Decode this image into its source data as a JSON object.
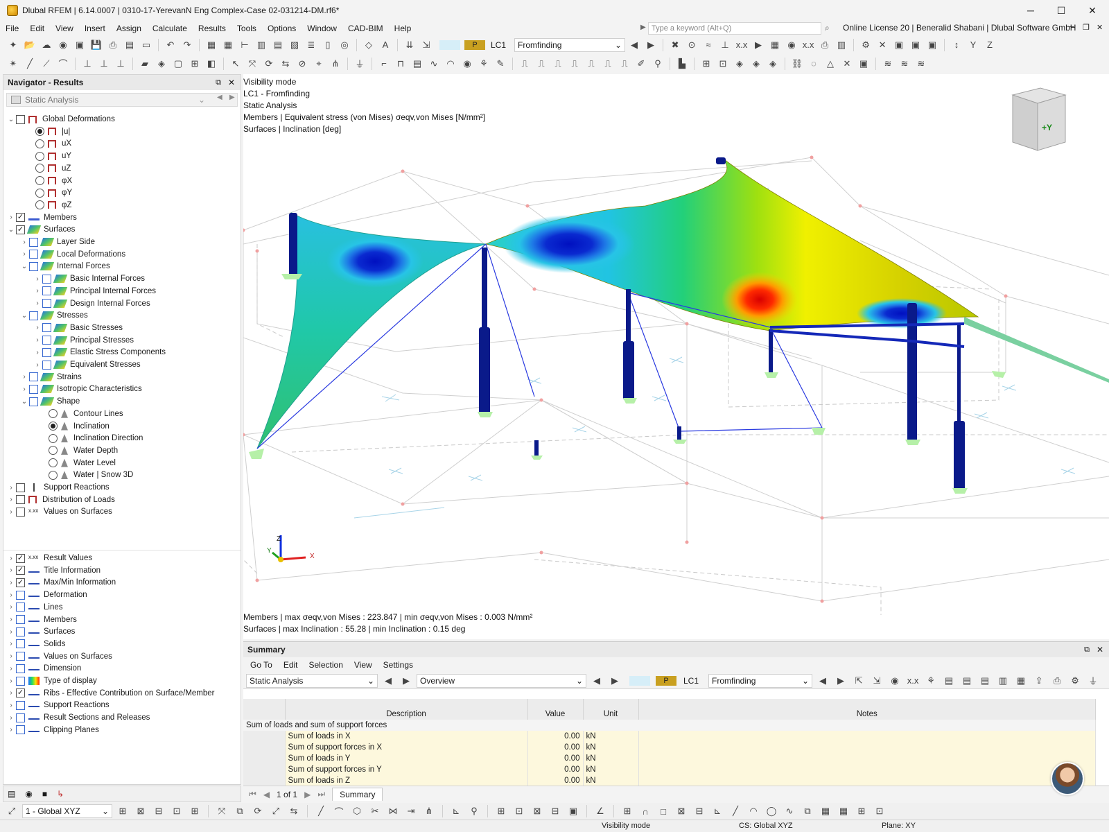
{
  "window": {
    "title": "Dlubal RFEM | 6.14.0007 | 0310-17-YerevanN Eng Complex-Case 02-031214-DM.rf6*",
    "minimize": "─",
    "maximize": "☐",
    "close": "✕"
  },
  "menu": {
    "items": [
      "File",
      "Edit",
      "View",
      "Insert",
      "Assign",
      "Calculate",
      "Results",
      "Tools",
      "Options",
      "Window",
      "CAD-BIM",
      "Help"
    ],
    "search_placeholder": "Type a keyword (Alt+Q)",
    "license": "Online License 20 | Beneralid Shabani | Dlubal Software GmbH"
  },
  "toolbar": {
    "loadcase_tag": "P",
    "loadcase_id": "LC1",
    "loadcase_name": "Fromfinding"
  },
  "navigator": {
    "title": "Navigator - Results",
    "analysis": "Static Analysis",
    "tree": [
      {
        "label": "Global Deformations",
        "level": 0,
        "type": "cb",
        "checked": false,
        "expanded": true,
        "icon": "deformation-icon"
      },
      {
        "label": "|u|",
        "level": 1,
        "type": "rb",
        "checked": true,
        "icon": "deformation-icon"
      },
      {
        "label": "uX",
        "level": 1,
        "type": "rb",
        "checked": false,
        "icon": "deformation-icon"
      },
      {
        "label": "uY",
        "level": 1,
        "type": "rb",
        "checked": false,
        "icon": "deformation-icon"
      },
      {
        "label": "uZ",
        "level": 1,
        "type": "rb",
        "checked": false,
        "icon": "deformation-icon"
      },
      {
        "label": "φX",
        "level": 1,
        "type": "rb",
        "checked": false,
        "icon": "deformation-icon"
      },
      {
        "label": "φY",
        "level": 1,
        "type": "rb",
        "checked": false,
        "icon": "deformation-icon"
      },
      {
        "label": "φZ",
        "level": 1,
        "type": "rb",
        "checked": false,
        "icon": "deformation-icon"
      },
      {
        "label": "Members",
        "level": 0,
        "type": "cb",
        "checked": true,
        "expanded": false,
        "icon": "members-icon"
      },
      {
        "label": "Surfaces",
        "level": 0,
        "type": "cb",
        "checked": true,
        "expanded": true,
        "icon": "surface-icon"
      },
      {
        "label": "Layer Side",
        "level": 1,
        "type": "cb",
        "checked": false,
        "expanded": false,
        "icon": "surface-icon"
      },
      {
        "label": "Local Deformations",
        "level": 1,
        "type": "cb",
        "checked": false,
        "expanded": false,
        "icon": "surface-icon"
      },
      {
        "label": "Internal Forces",
        "level": 1,
        "type": "cb",
        "checked": false,
        "expanded": true,
        "icon": "surface-icon"
      },
      {
        "label": "Basic Internal Forces",
        "level": 2,
        "type": "cb",
        "checked": false,
        "expanded": false,
        "icon": "surface-icon"
      },
      {
        "label": "Principal Internal Forces",
        "level": 2,
        "type": "cb",
        "checked": false,
        "expanded": false,
        "icon": "surface-icon"
      },
      {
        "label": "Design Internal Forces",
        "level": 2,
        "type": "cb",
        "checked": false,
        "expanded": false,
        "icon": "surface-icon"
      },
      {
        "label": "Stresses",
        "level": 1,
        "type": "cb",
        "checked": false,
        "expanded": true,
        "icon": "surface-icon"
      },
      {
        "label": "Basic Stresses",
        "level": 2,
        "type": "cb",
        "checked": false,
        "expanded": false,
        "icon": "surface-icon"
      },
      {
        "label": "Principal Stresses",
        "level": 2,
        "type": "cb",
        "checked": false,
        "expanded": false,
        "icon": "surface-icon"
      },
      {
        "label": "Elastic Stress Components",
        "level": 2,
        "type": "cb",
        "checked": false,
        "expanded": false,
        "icon": "surface-icon"
      },
      {
        "label": "Equivalent Stresses",
        "level": 2,
        "type": "cb",
        "checked": false,
        "expanded": false,
        "icon": "surface-icon"
      },
      {
        "label": "Strains",
        "level": 1,
        "type": "cb",
        "checked": false,
        "expanded": false,
        "icon": "surface-icon"
      },
      {
        "label": "Isotropic Characteristics",
        "level": 1,
        "type": "cb",
        "checked": false,
        "expanded": false,
        "icon": "surface-icon"
      },
      {
        "label": "Shape",
        "level": 1,
        "type": "cb",
        "checked": false,
        "expanded": true,
        "icon": "surface-icon"
      },
      {
        "label": "Contour Lines",
        "level": 2,
        "type": "rb",
        "checked": false,
        "icon": "shape-icon"
      },
      {
        "label": "Inclination",
        "level": 2,
        "type": "rb",
        "checked": true,
        "icon": "shape-icon"
      },
      {
        "label": "Inclination Direction",
        "level": 2,
        "type": "rb",
        "checked": false,
        "icon": "shape-icon"
      },
      {
        "label": "Water Depth",
        "level": 2,
        "type": "rb",
        "checked": false,
        "icon": "shape-icon"
      },
      {
        "label": "Water Level",
        "level": 2,
        "type": "rb",
        "checked": false,
        "icon": "shape-icon"
      },
      {
        "label": "Water | Snow 3D",
        "level": 2,
        "type": "rb",
        "checked": false,
        "icon": "shape-icon"
      },
      {
        "label": "Support Reactions",
        "level": 0,
        "type": "cb",
        "checked": false,
        "expanded": false,
        "icon": "support-icon"
      },
      {
        "label": "Distribution of Loads",
        "level": 0,
        "type": "cb",
        "checked": false,
        "expanded": false,
        "icon": "deformation-icon"
      },
      {
        "label": "Values on Surfaces",
        "level": 0,
        "type": "cb",
        "checked": false,
        "expanded": false,
        "icon": "values-icon"
      }
    ],
    "tree2": [
      {
        "label": "Result Values",
        "checked": true,
        "icon": "values-icon"
      },
      {
        "label": "Title Information",
        "checked": true,
        "icon": "result-icon"
      },
      {
        "label": "Max/Min Information",
        "checked": true,
        "icon": "result-icon"
      },
      {
        "label": "Deformation",
        "checked": false,
        "icon": "result-icon"
      },
      {
        "label": "Lines",
        "checked": false,
        "icon": "result-icon"
      },
      {
        "label": "Members",
        "checked": false,
        "icon": "result-icon"
      },
      {
        "label": "Surfaces",
        "checked": false,
        "icon": "result-icon"
      },
      {
        "label": "Solids",
        "checked": false,
        "icon": "result-icon"
      },
      {
        "label": "Values on Surfaces",
        "checked": false,
        "icon": "result-icon"
      },
      {
        "label": "Dimension",
        "checked": false,
        "icon": "result-icon"
      },
      {
        "label": "Type of display",
        "checked": false,
        "icon": "color-scale-icon"
      },
      {
        "label": "Ribs - Effective Contribution on Surface/Member",
        "checked": true,
        "icon": "result-icon"
      },
      {
        "label": "Support Reactions",
        "checked": false,
        "icon": "result-icon"
      },
      {
        "label": "Result Sections and Releases",
        "checked": false,
        "icon": "result-icon"
      },
      {
        "label": "Clipping Planes",
        "checked": false,
        "icon": "result-icon"
      }
    ]
  },
  "viewport": {
    "info": [
      "Visibility mode",
      "LC1 - Fromfinding",
      "Static Analysis",
      "Members | Equivalent stress (von Mises) σeqv,von Mises [N/mm²]",
      "Surfaces | Inclination  [deg]"
    ],
    "maxmin": [
      "Members | max σeqv,von Mises : 223.847 | min σeqv,von Mises : 0.003 N/mm²",
      "Surfaces | max Inclination : 55.28 | min Inclination : 0.15 deg"
    ],
    "axis": {
      "x": "X",
      "y": "Y",
      "z": "Z"
    },
    "cube_label": "+Y"
  },
  "summary": {
    "title": "Summary",
    "menu": [
      "Go To",
      "Edit",
      "Selection",
      "View",
      "Settings"
    ],
    "analysis": "Static Analysis",
    "view": "Overview",
    "loadcase_tag": "P",
    "loadcase_id": "LC1",
    "loadcase_name": "Fromfinding",
    "columns": [
      "Description",
      "Value",
      "Unit",
      "Notes"
    ],
    "group": "Sum of loads and sum of support forces",
    "rows": [
      {
        "desc": "Sum of loads in X",
        "value": "0.00",
        "unit": "kN"
      },
      {
        "desc": "Sum of support forces in X",
        "value": "0.00",
        "unit": "kN"
      },
      {
        "desc": "Sum of loads in Y",
        "value": "0.00",
        "unit": "kN"
      },
      {
        "desc": "Sum of support forces in Y",
        "value": "0.00",
        "unit": "kN"
      },
      {
        "desc": "Sum of loads in Z",
        "value": "0.00",
        "unit": "kN"
      }
    ],
    "pager": "1 of 1",
    "tab": "Summary"
  },
  "bottom": {
    "cs_combo": "1 - Global XYZ"
  },
  "status": {
    "mode": "Visibility mode",
    "cs": "CS: Global XYZ",
    "plane": "Plane: XY"
  },
  "colors": {
    "accent": "#0a7ad6",
    "member": "#0a1a8a",
    "stress_high": "#e00000",
    "stress_low": "#0a2ad0"
  }
}
